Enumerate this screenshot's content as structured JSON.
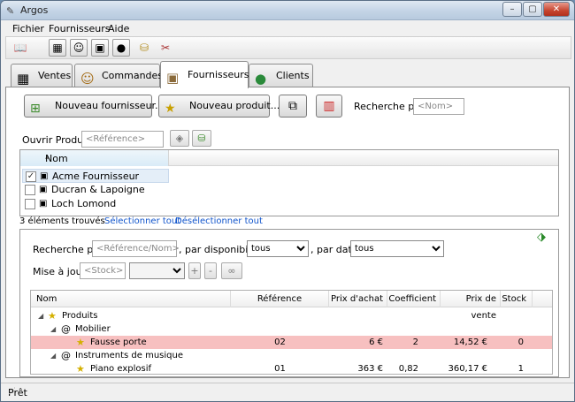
{
  "window": {
    "title": "Argos",
    "minimize": "–",
    "maximize": "▢",
    "close": "✕"
  },
  "menu": [
    {
      "label": "Fichier"
    },
    {
      "label": "Fournisseurs"
    },
    {
      "label": "Aide"
    }
  ],
  "toolbar": {
    "icons": [
      "book-icon",
      "cash-register-icon",
      "clerk-icon",
      "supplier-box-icon",
      "client-icon",
      "coins-icon",
      "tools-icon"
    ]
  },
  "tabs": [
    {
      "label": "Ventes",
      "icon": "cash-register-icon"
    },
    {
      "label": "Commandes",
      "icon": "clerk-icon"
    },
    {
      "label": "Fournisseurs",
      "icon": "supplier-box-icon",
      "active": true
    },
    {
      "label": "Clients",
      "icon": "client-icon"
    }
  ],
  "actions": {
    "new_supplier": "Nouveau fournisseur...",
    "new_product": "Nouveau produit...",
    "search_by_label": "Recherche par",
    "search_placeholder": "<Nom>"
  },
  "open_product": {
    "label": "Ouvrir Produit",
    "placeholder": "<Référence>"
  },
  "suppliers": {
    "column": "Nom",
    "rows": [
      {
        "name": "Acme Fournisseur",
        "checked": true,
        "selected": true
      },
      {
        "name": "Ducran & Lapoigne",
        "checked": false
      },
      {
        "name": "Loch Lomond",
        "checked": false
      }
    ],
    "count": "3 éléments trouvés",
    "select_all": "Sélectionner tout",
    "deselect_all": "Désélectionner tout"
  },
  "filters": {
    "search_label": "Recherche par",
    "search_placeholder": "<Référence/Nom>",
    "availability_label": ", par disponibilité",
    "availability_value": "tous",
    "date_label": ", par date",
    "date_value": "tous",
    "update_label": "Mise à jour",
    "stock_placeholder": "<Stock>",
    "plus": "+",
    "minus": "-"
  },
  "products_table": {
    "columns": [
      "Nom",
      "Référence",
      "Prix d'achat",
      "Coefficient",
      "Prix de vente",
      "Stock"
    ],
    "root": "Produits",
    "groups": [
      {
        "name": "Mobilier",
        "items": [
          {
            "name": "Fausse porte",
            "reference": "02",
            "purchase_price": "6 €",
            "coefficient": "2",
            "sale_price": "14,52 €",
            "stock": "0",
            "highlight": true
          }
        ]
      },
      {
        "name": "Instruments de musique",
        "items": [
          {
            "name": "Piano explosif",
            "reference": "01",
            "purchase_price": "363 €",
            "coefficient": "0,82",
            "sale_price": "360,17 €",
            "stock": "1"
          }
        ]
      }
    ]
  },
  "status": "Prêt"
}
